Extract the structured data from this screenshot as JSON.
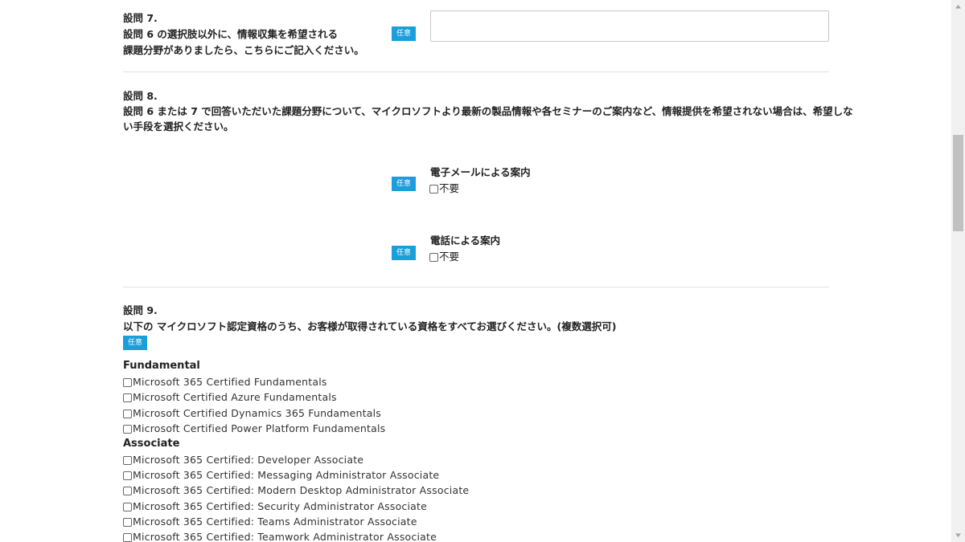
{
  "q7": {
    "title": "設問 7.",
    "line1": "設問 6 の選択肢以外に、情報収集を希望される",
    "line2": "課題分野がありましたら、こちらにご記入ください。",
    "badge": "任意",
    "input_value": ""
  },
  "q8": {
    "title": "設問 8.",
    "line1": "設問 6 または 7 で回答いただいた課題分野について、マイクロソフトより最新の製品情報や各セミナーのご案内など、情報提供を希望されない場合は、希望しな",
    "line2": "い手段を選択ください。",
    "options": [
      {
        "badge": "任意",
        "label": "電子メールによる案内",
        "check_label": "不要"
      },
      {
        "badge": "任意",
        "label": "電話による案内",
        "check_label": "不要"
      }
    ]
  },
  "q9": {
    "title": "設問 9.",
    "text": "以下の マイクロソフト認定資格のうち、お客様が取得されている資格をすべてお選びください。(複数選択可)",
    "badge": "任意",
    "groups": [
      {
        "name": "Fundamental",
        "items": [
          "Microsoft 365 Certified Fundamentals",
          "Microsoft Certified Azure Fundamentals",
          "Microsoft Certified Dynamics 365 Fundamentals",
          "Microsoft Certified Power Platform Fundamentals"
        ]
      },
      {
        "name": "Associate",
        "items": [
          "Microsoft 365 Certified: Developer Associate",
          "Microsoft 365 Certified: Messaging Administrator Associate",
          "Microsoft 365 Certified: Modern Desktop Administrator Associate",
          "Microsoft 365 Certified: Security Administrator Associate",
          "Microsoft 365 Certified: Teams Administrator Associate",
          "Microsoft 365 Certified: Teamwork Administrator Associate"
        ]
      }
    ]
  },
  "icons": {
    "scroll_up": "scroll-up-arrow-icon",
    "scroll_down": "scroll-down-arrow-icon"
  },
  "colors": {
    "badge": "#1a9fdb",
    "divider": "#e2e2e2",
    "scrollbar_track": "#f1f1f1",
    "scrollbar_thumb": "#c1c1c1"
  }
}
